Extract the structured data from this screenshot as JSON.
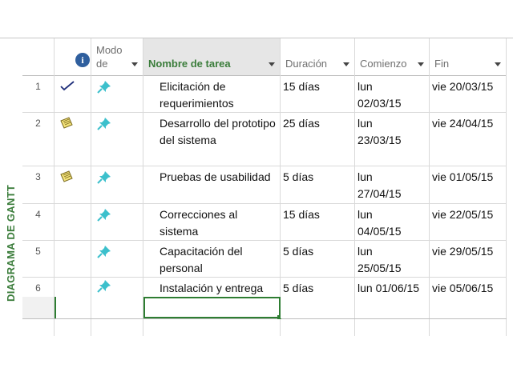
{
  "side_label": "DIAGRAMA DE GANTT",
  "columns": {
    "info": "i",
    "modo": "Modo de",
    "nombre": "Nombre de tarea",
    "duracion": "Duración",
    "comienzo": "Comienzo",
    "fin": "Fin"
  },
  "tasks": [
    {
      "id": "1",
      "indicator": "check-icon",
      "mode": "pin-icon",
      "name": "Elicitación de requerimientos",
      "duration": "15 días",
      "start": "lun 02/03/15",
      "finish": "vie 20/03/15"
    },
    {
      "id": "2",
      "indicator": "note-icon",
      "mode": "pin-icon",
      "name": "Desarrollo del prototipo del sistema",
      "duration": "25 días",
      "start": "lun 23/03/15",
      "finish": "vie 24/04/15"
    },
    {
      "id": "3",
      "indicator": "note-icon",
      "mode": "pin-icon",
      "name": "Pruebas de usabilidad",
      "duration": "5 días",
      "start": "lun 27/04/15",
      "finish": "vie 01/05/15"
    },
    {
      "id": "4",
      "indicator": "",
      "mode": "pin-icon",
      "name": "Correcciones al sistema",
      "duration": "15 días",
      "start": "lun 04/05/15",
      "finish": "vie 22/05/15"
    },
    {
      "id": "5",
      "indicator": "",
      "mode": "pin-icon",
      "name": "Capacitación del personal",
      "duration": "5 días",
      "start": "lun 25/05/15",
      "finish": "vie 29/05/15"
    },
    {
      "id": "6",
      "indicator": "",
      "mode": "pin-icon",
      "name": "Instalación y entrega",
      "duration": "5 días",
      "start": "lun 01/06/15",
      "finish": "vie 05/06/15"
    }
  ],
  "colors": {
    "accent_green": "#3b7d3b",
    "selection_green": "#2e7d32",
    "pin": "#3cc0cc",
    "info_blue": "#2f5f9e"
  }
}
